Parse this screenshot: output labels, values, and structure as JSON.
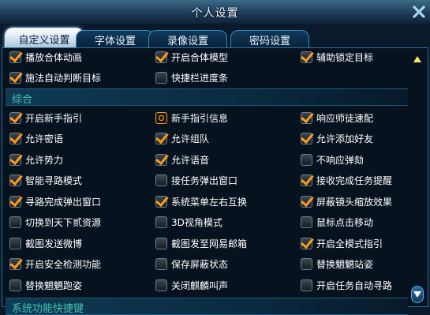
{
  "window": {
    "title": "个人设置",
    "close_icon": "close-x-icon"
  },
  "tabs": [
    {
      "label": "自定义设置",
      "active": true
    },
    {
      "label": "字体设置",
      "active": false
    },
    {
      "label": "录像设置",
      "active": false
    },
    {
      "label": "密码设置",
      "active": false
    }
  ],
  "rows": [
    {
      "type": "options",
      "items": [
        {
          "label": "播放合体动画",
          "checked": true
        },
        {
          "label": "开启合体模型",
          "checked": true
        },
        {
          "label": "辅助锁定目标",
          "checked": true
        }
      ]
    },
    {
      "type": "options",
      "items": [
        {
          "label": "施法自动判断目标",
          "checked": true
        },
        {
          "label": "快捷栏进度条",
          "checked": false
        },
        null
      ]
    },
    {
      "type": "section",
      "label": "综合"
    },
    {
      "type": "options",
      "items": [
        {
          "label": "开启新手指引",
          "checked": true
        },
        {
          "label": "新手指引信息",
          "checked": false,
          "icon": "info"
        },
        {
          "label": "响应师徒速配",
          "checked": true
        }
      ]
    },
    {
      "type": "options",
      "items": [
        {
          "label": "允许密语",
          "checked": true
        },
        {
          "label": "允许组队",
          "checked": true
        },
        {
          "label": "允许添加好友",
          "checked": true
        }
      ]
    },
    {
      "type": "options",
      "items": [
        {
          "label": "允许势力",
          "checked": true
        },
        {
          "label": "允许语音",
          "checked": true
        },
        {
          "label": "不响应弹劾",
          "checked": false
        }
      ]
    },
    {
      "type": "options",
      "items": [
        {
          "label": "智能寻路模式",
          "checked": true
        },
        {
          "label": "接任务弹出窗口",
          "checked": false
        },
        {
          "label": "接收完成任务提醒",
          "checked": true
        }
      ]
    },
    {
      "type": "options",
      "items": [
        {
          "label": "寻路完成弹出窗口",
          "checked": true
        },
        {
          "label": "系统菜单左右互换",
          "checked": true
        },
        {
          "label": "屏蔽镜头缩放效果",
          "checked": true
        }
      ]
    },
    {
      "type": "options",
      "items": [
        {
          "label": "切换到天下贰资源",
          "checked": false
        },
        {
          "label": "3D视角模式",
          "checked": false
        },
        {
          "label": "鼠标点击移动",
          "checked": false
        }
      ]
    },
    {
      "type": "options",
      "items": [
        {
          "label": "截图发送微博",
          "checked": false
        },
        {
          "label": "截图发至网易邮箱",
          "checked": false
        },
        {
          "label": "开启全模式指引",
          "checked": true
        }
      ]
    },
    {
      "type": "options",
      "items": [
        {
          "label": "开启安全检测功能",
          "checked": true
        },
        {
          "label": "保存屏蔽状态",
          "checked": false
        },
        {
          "label": "替换魍魉站姿",
          "checked": false
        }
      ]
    },
    {
      "type": "options",
      "items": [
        {
          "label": "替换魍魉跑姿",
          "checked": false
        },
        {
          "label": "关闭麒麟叫声",
          "checked": false
        },
        {
          "label": "开启任务自动寻路",
          "checked": false
        }
      ]
    },
    {
      "type": "section",
      "label": "系统功能快捷键"
    }
  ],
  "scrollbar": {
    "up_icon": "arrow-up-icon",
    "down_icon": "arrow-down-icon"
  },
  "colors": {
    "check": "#ff9a1a",
    "section_text": "#45c4b0",
    "tab_border": "#2f8fc7"
  }
}
